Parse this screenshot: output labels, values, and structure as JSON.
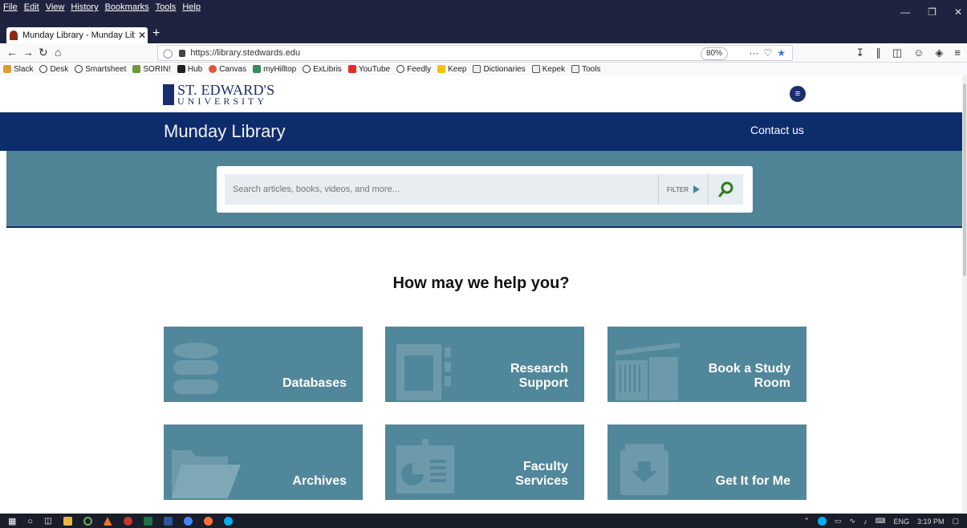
{
  "browser": {
    "menus": [
      "File",
      "Edit",
      "View",
      "History",
      "Bookmarks",
      "Tools",
      "Help"
    ],
    "tab_title": "Munday Library - Munday Libra",
    "new_tab": "+",
    "url": "https://library.stedwards.edu",
    "zoom": "80%",
    "bookmarks": [
      "Slack",
      "Desk",
      "Smartsheet",
      "SORIN!",
      "Hub",
      "Canvas",
      "myHilltop",
      "ExLibris",
      "YouTube",
      "Feedly",
      "Keep",
      "Dictionaries",
      "Kepek",
      "Tools"
    ]
  },
  "site": {
    "logo_line1": "ST. EDWARD'S",
    "logo_line2": "UNIVERSITY",
    "library_name": "Munday Library",
    "contact": "Contact us",
    "search_placeholder": "Search articles, books, videos, and more...",
    "filter_label": "FILTER",
    "help_title": "How may we help you?",
    "tiles": [
      {
        "label": "Databases",
        "icon": "database-icon"
      },
      {
        "label": "Research Support",
        "icon": "document-icon"
      },
      {
        "label": "Book a Study Room",
        "icon": "room-icon"
      },
      {
        "label": "Archives",
        "icon": "folder-icon"
      },
      {
        "label": "Faculty Services",
        "icon": "presentation-icon"
      },
      {
        "label": "Get It for Me",
        "icon": "download-box-icon"
      }
    ]
  },
  "taskbar": {
    "language": "ENG",
    "time": "3:19 PM"
  },
  "colors": {
    "navy": "#0d2c6c",
    "teal": "#51879a",
    "search_band": "#4f8496",
    "search_icon": "#2e7d1f"
  }
}
